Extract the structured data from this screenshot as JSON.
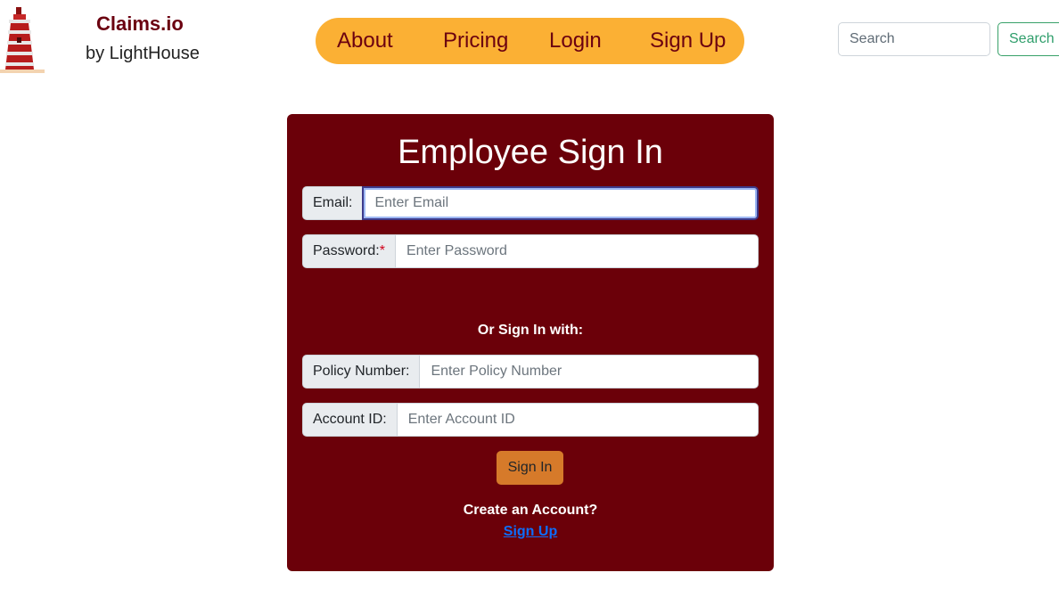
{
  "brand": {
    "title": "Claims.io",
    "subtitle": "by LightHouse",
    "logo_icon": "lighthouse-icon"
  },
  "nav": {
    "items": [
      {
        "label": "About"
      },
      {
        "label": "Pricing"
      },
      {
        "label": "Login"
      },
      {
        "label": "Sign Up"
      }
    ]
  },
  "search": {
    "placeholder": "Search",
    "button_label": "Search"
  },
  "signin_form": {
    "title": "Employee Sign In",
    "email": {
      "label": "Email:",
      "placeholder": "Enter Email",
      "value": ""
    },
    "password": {
      "label": "Password:",
      "required_mark": "*",
      "placeholder": "Enter Password",
      "value": ""
    },
    "alt_heading": "Or Sign In with:",
    "policy_number": {
      "label": "Policy Number:",
      "placeholder": "Enter Policy Number",
      "value": ""
    },
    "account_id": {
      "label": "Account ID:",
      "placeholder": "Enter Account ID",
      "value": ""
    },
    "submit_label": "Sign In",
    "create_account_text": "Create an Account?",
    "signup_link_label": "Sign Up"
  },
  "colors": {
    "brand_red": "#6b0010",
    "nav_bg": "#fbb034",
    "card_bg": "#6b0009",
    "signin_button": "#d67a2a",
    "link_blue": "#0d6efd",
    "search_green": "#2f9e6b"
  }
}
